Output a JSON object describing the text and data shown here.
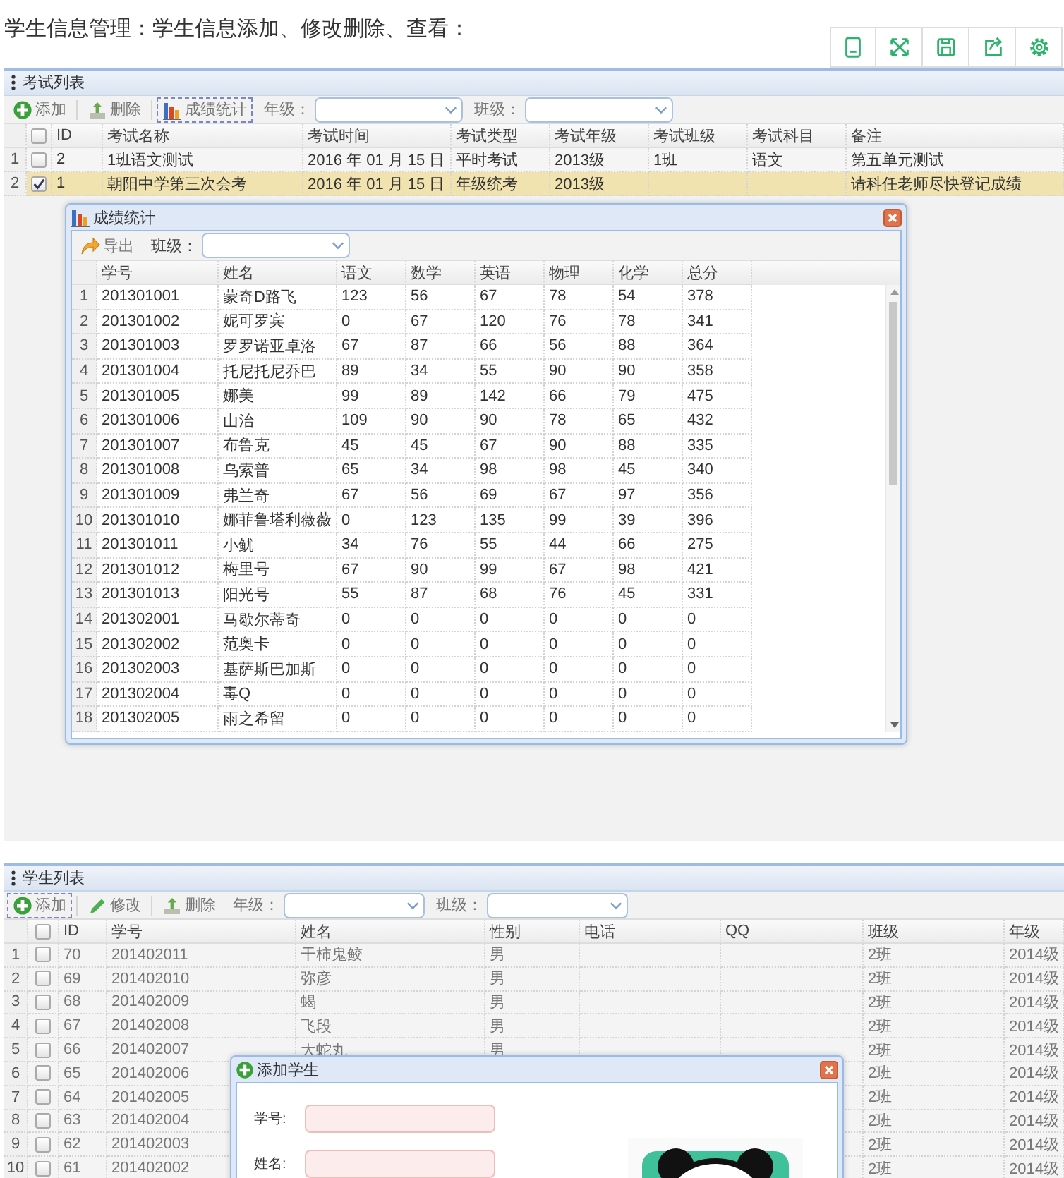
{
  "heading": "学生信息管理：学生信息添加、修改删除、查看：",
  "tool_icons": [
    {
      "kind": "tablet"
    },
    {
      "kind": "expand"
    },
    {
      "kind": "save"
    },
    {
      "kind": "share"
    },
    {
      "kind": "settings"
    }
  ],
  "exam_panel": {
    "title": "考试列表",
    "toolbar": {
      "buttons": [
        {
          "kind": "add",
          "label": "添加",
          "focused": false
        },
        {
          "kind": "delete",
          "label": "删除",
          "focused": false
        },
        {
          "kind": "chart",
          "label": "成绩统计",
          "focused": true
        }
      ],
      "filters": [
        {
          "label": "年级："
        },
        {
          "label": "班级："
        }
      ]
    },
    "table": {
      "all_checked": false,
      "columns": [
        "ID",
        "考试名称",
        "考试时间",
        "考试类型",
        "考试年级",
        "考试班级",
        "考试科目",
        "备注"
      ],
      "rows": [
        {
          "number": "1",
          "checked": false,
          "selected": false,
          "cells": [
            "2",
            "1班语文测试",
            "2016 年 01 月 15 日",
            "平时考试",
            "2013级",
            "1班",
            "语文",
            "第五单元测试"
          ]
        },
        {
          "number": "2",
          "checked": true,
          "selected": true,
          "cells": [
            "1",
            "朝阳中学第三次会考",
            "2016 年 01 月 15 日",
            "年级统考",
            "2013级",
            null,
            null,
            "请科任老师尽快登记成绩"
          ]
        }
      ]
    }
  },
  "score_dialog": {
    "title": "成绩统计",
    "export_label": "导出",
    "filter_label": "班级：",
    "table": {
      "columns": [
        "学号",
        "姓名",
        "语文",
        "数学",
        "英语",
        "物理",
        "化学",
        "总分"
      ],
      "rows": [
        {
          "number": "1",
          "cells": [
            "201301001",
            "蒙奇D路飞",
            "123",
            "56",
            "67",
            "78",
            "54",
            "378"
          ]
        },
        {
          "number": "2",
          "cells": [
            "201301002",
            "妮可罗宾",
            "0",
            "67",
            "120",
            "76",
            "78",
            "341"
          ]
        },
        {
          "number": "3",
          "cells": [
            "201301003",
            "罗罗诺亚卓洛",
            "67",
            "87",
            "66",
            "56",
            "88",
            "364"
          ]
        },
        {
          "number": "4",
          "cells": [
            "201301004",
            "托尼托尼乔巴",
            "89",
            "34",
            "55",
            "90",
            "90",
            "358"
          ]
        },
        {
          "number": "5",
          "cells": [
            "201301005",
            "娜美",
            "99",
            "89",
            "142",
            "66",
            "79",
            "475"
          ]
        },
        {
          "number": "6",
          "cells": [
            "201301006",
            "山治",
            "109",
            "90",
            "90",
            "78",
            "65",
            "432"
          ]
        },
        {
          "number": "7",
          "cells": [
            "201301007",
            "布鲁克",
            "45",
            "45",
            "67",
            "90",
            "88",
            "335"
          ]
        },
        {
          "number": "8",
          "cells": [
            "201301008",
            "乌索普",
            "65",
            "34",
            "98",
            "98",
            "45",
            "340"
          ]
        },
        {
          "number": "9",
          "cells": [
            "201301009",
            "弗兰奇",
            "67",
            "56",
            "69",
            "67",
            "97",
            "356"
          ]
        },
        {
          "number": "10",
          "cells": [
            "201301010",
            "娜菲鲁塔利薇薇",
            "0",
            "123",
            "135",
            "99",
            "39",
            "396"
          ]
        },
        {
          "number": "11",
          "cells": [
            "201301011",
            "小鱿",
            "34",
            "76",
            "55",
            "44",
            "66",
            "275"
          ]
        },
        {
          "number": "12",
          "cells": [
            "201301012",
            "梅里号",
            "67",
            "90",
            "99",
            "67",
            "98",
            "421"
          ]
        },
        {
          "number": "13",
          "cells": [
            "201301013",
            "阳光号",
            "55",
            "87",
            "68",
            "76",
            "45",
            "331"
          ]
        },
        {
          "number": "14",
          "cells": [
            "201302001",
            "马歇尔蒂奇",
            "0",
            "0",
            "0",
            "0",
            "0",
            "0"
          ]
        },
        {
          "number": "15",
          "cells": [
            "201302002",
            "范奥卡",
            "0",
            "0",
            "0",
            "0",
            "0",
            "0"
          ]
        },
        {
          "number": "16",
          "cells": [
            "201302003",
            "基萨斯巴加斯",
            "0",
            "0",
            "0",
            "0",
            "0",
            "0"
          ]
        },
        {
          "number": "17",
          "cells": [
            "201302004",
            "毒Q",
            "0",
            "0",
            "0",
            "0",
            "0",
            "0"
          ]
        },
        {
          "number": "18",
          "cells": [
            "201302005",
            "雨之希留",
            "0",
            "0",
            "0",
            "0",
            "0",
            "0"
          ]
        }
      ]
    }
  },
  "student_panel": {
    "title": "学生列表",
    "toolbar": {
      "buttons": [
        {
          "kind": "add",
          "label": "添加",
          "focused": true
        },
        {
          "kind": "edit",
          "label": "修改",
          "focused": false
        },
        {
          "kind": "delete",
          "label": "删除",
          "focused": false
        }
      ],
      "filters": [
        {
          "label": "年级："
        },
        {
          "label": "班级："
        }
      ]
    },
    "table": {
      "all_checked": false,
      "columns": [
        "ID",
        "学号",
        "姓名",
        "性别",
        "电话",
        "QQ",
        "班级",
        "年级"
      ],
      "rows": [
        {
          "number": "1",
          "checked": false,
          "cells": [
            "70",
            "201402011",
            "干柿鬼鲛",
            "男",
            null,
            null,
            "2班",
            "2014级"
          ]
        },
        {
          "number": "2",
          "checked": false,
          "cells": [
            "69",
            "201402010",
            "弥彦",
            "男",
            null,
            null,
            "2班",
            "2014级"
          ]
        },
        {
          "number": "3",
          "checked": false,
          "cells": [
            "68",
            "201402009",
            "蝎",
            "男",
            null,
            null,
            "2班",
            "2014级"
          ]
        },
        {
          "number": "4",
          "checked": false,
          "cells": [
            "67",
            "201402008",
            "飞段",
            "男",
            null,
            null,
            "2班",
            "2014级"
          ]
        },
        {
          "number": "5",
          "checked": false,
          "cells": [
            "66",
            "201402007",
            "大蛇丸",
            "男",
            null,
            null,
            "2班",
            "2014级"
          ]
        },
        {
          "number": "6",
          "checked": false,
          "cells": [
            "65",
            "201402006",
            null,
            null,
            null,
            null,
            "2班",
            "2014级"
          ]
        },
        {
          "number": "7",
          "checked": false,
          "cells": [
            "64",
            "201402005",
            null,
            null,
            null,
            null,
            "2班",
            "2014级"
          ]
        },
        {
          "number": "8",
          "checked": false,
          "cells": [
            "63",
            "201402004",
            null,
            null,
            null,
            null,
            "2班",
            "2014级"
          ]
        },
        {
          "number": "9",
          "checked": false,
          "cells": [
            "62",
            "201402003",
            null,
            null,
            null,
            null,
            "2班",
            "2014级"
          ]
        },
        {
          "number": "10",
          "checked": false,
          "cells": [
            "61",
            "201402002",
            null,
            null,
            null,
            null,
            "2班",
            "2014级"
          ]
        }
      ]
    }
  },
  "add_dialog": {
    "title": "添加学生",
    "fields": [
      {
        "label": "学号:"
      },
      {
        "label": "姓名:"
      }
    ]
  }
}
